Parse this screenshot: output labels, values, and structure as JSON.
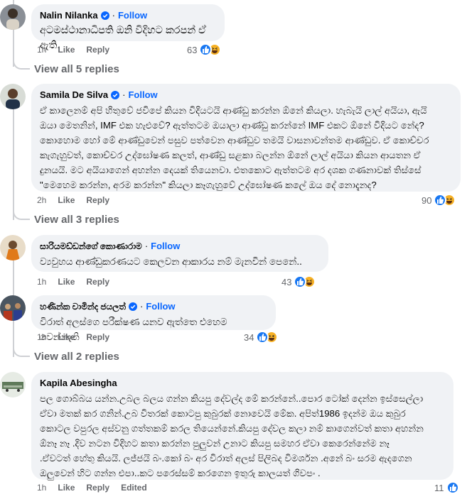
{
  "comments": [
    {
      "author": "Nalin Nilanka",
      "verified": true,
      "follow_label": "Follow",
      "text": "අටමස්ථානාධිපති ඔනි විදිහට කරපන් ඒ ඇති.",
      "time": "1h",
      "like_label": "Like",
      "reply_label": "Reply",
      "reaction_count": "63",
      "view_replies": "View all 5 replies"
    },
    {
      "author": "Samila De Silva",
      "verified": true,
      "follow_label": "Follow",
      "lines": [
        "ඒ කාලෙනම් අපි හිතුවේ ජවිපේ කියන විදියටයි ආණ්ඩු කරන්න ඕනේ කියලා. හැබැයි ලාල් අයියා, ඇයි",
        "ඔයා මෙතනින්, IMF එක හැළුවේ? ඇත්තටම ඔයාලා ආණ්ඩු කරන්නේ IMF එකට ඕනේ විදියට නේද?",
        "කොහොම හෝ මේ ආණ්ඩුවෙන් පසුව පත්වෙන ආණ්ඩුව තමයි වාසනාවන්තම ආණ්ඩුව. ඒ කොච්චර",
        "කැගැහුවත්, කොච්චර උද්ඝෝෂණ කලත්, ආණ්ඩු සළකා බලන්න ඕනේ ලාල් අයියා කියන ආයතන ඒ",
        "දුනයයි. මට අයියාගෙන් අහන්න දෙයක් තියෙනවා. එතකොට ඇත්තටම අර දශක ගණනාවක් තිස්සේ",
        "\"මෙහෙම කරන්න, අරම කරන්න\" කියලා කෑගැහුවේ උද්ඝෝෂණ කලේ ඔය දේ නොදැනද?"
      ],
      "time": "2h",
      "like_label": "Like",
      "reply_label": "Reply",
      "reaction_count": "90",
      "view_replies": "View all 3 replies"
    },
    {
      "author": "සාරියමඩ්ඩන්ගේ කොණාරාම",
      "verified": false,
      "follow_label": "Follow",
      "text": "ව්‍යවුහය ආණ්ඩුකරණයට කෙලවන ආකාරය නම් මැනවින් පෙනේ..",
      "time": "1h",
      "like_label": "Like",
      "reply_label": "Reply",
      "reaction_count": "43"
    },
    {
      "author": "හණින්ක චාමින්ද ජයලත්",
      "verified": true,
      "follow_label": "Follow",
      "text": "විරාත් අලස්ගෙ පරීක්ෂණ යනව ඇත්තෙ එහෙම වෙන්නැති",
      "time": "1h",
      "like_label": "Like",
      "reply_label": "Reply",
      "reaction_count": "34",
      "view_replies": "View all 2 replies"
    },
    {
      "author": "Kapila Abesingha",
      "verified": false,
      "lines": [
        "පල ගොබ්බය යන්න.උබල බලය ගන්න කියපු දේවල්ද මේ කරන්නේ..පොර ටෝක් දෙන්න ඉස්සෙල්ලා",
        "ඒවා මතක් කර ගනින්.උබ විතරක් කොටපු කුබුරක් නොවෙයි මේක. අපිත්1986 ඉදන්ම ඔය කුබුර",
        "කොටල වපුරල අස්වනු ගත්තකම් කරල තියෙන්නේ.කියපු දේවල කලා නම් කාගෙන්වත් කතා අහන්න",
        "ඕනෑ නෑ .දිව නටන විදිහට කතා කරන්න පුලුවන් උනාට කියපු සමහර ඒවා කෙරෙන්නේම නෑ",
        ".ඒවටත් හේතු කියයි. ලජ්ජයි බං.කෝ බං අර විරාත් අලස් පිලිබද විමර්ශන .අනේ බං සරම ඇදගෙන",
        "ඔලුවෙන් හිට ගන්න එපා..කට පරෙස්සම් කරගෙන ඉතුරු කාලයත් ගිවපං ."
      ],
      "time": "1h",
      "like_label": "Like",
      "reply_label": "Reply",
      "edited_label": "Edited",
      "reaction_count": "11"
    }
  ],
  "colors": {
    "bubble": "#f0f2f5",
    "follow": "#0866ff",
    "meta": "#65676b",
    "like_blue": "#1877f2",
    "haha_yellow": "#f7b125"
  }
}
